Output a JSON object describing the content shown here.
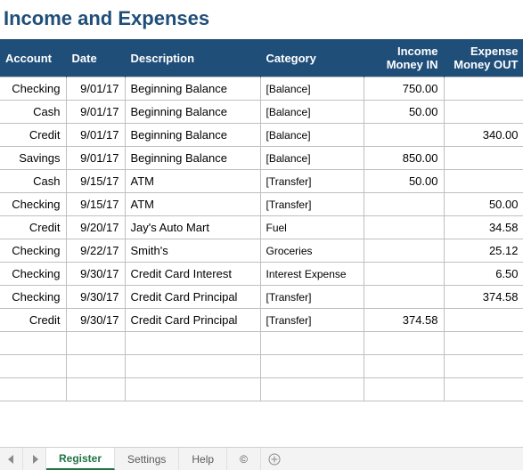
{
  "title": "Income and Expenses",
  "columns": {
    "account": "Account",
    "date": "Date",
    "description": "Description",
    "category": "Category",
    "income": "Income Money IN",
    "expense": "Expense Money OUT"
  },
  "rows": [
    {
      "account": "Checking",
      "date": "9/01/17",
      "description": "Beginning Balance",
      "category": "[Balance]",
      "income": "750.00",
      "expense": ""
    },
    {
      "account": "Cash",
      "date": "9/01/17",
      "description": "Beginning Balance",
      "category": "[Balance]",
      "income": "50.00",
      "expense": ""
    },
    {
      "account": "Credit",
      "date": "9/01/17",
      "description": "Beginning Balance",
      "category": "[Balance]",
      "income": "",
      "expense": "340.00"
    },
    {
      "account": "Savings",
      "date": "9/01/17",
      "description": "Beginning Balance",
      "category": "[Balance]",
      "income": "850.00",
      "expense": ""
    },
    {
      "account": "Cash",
      "date": "9/15/17",
      "description": "ATM",
      "category": "[Transfer]",
      "income": "50.00",
      "expense": ""
    },
    {
      "account": "Checking",
      "date": "9/15/17",
      "description": "ATM",
      "category": "[Transfer]",
      "income": "",
      "expense": "50.00"
    },
    {
      "account": "Credit",
      "date": "9/20/17",
      "description": "Jay's Auto Mart",
      "category": "Fuel",
      "income": "",
      "expense": "34.58"
    },
    {
      "account": "Checking",
      "date": "9/22/17",
      "description": "Smith's",
      "category": "Groceries",
      "income": "",
      "expense": "25.12"
    },
    {
      "account": "Checking",
      "date": "9/30/17",
      "description": "Credit Card Interest",
      "category": "Interest Expense",
      "income": "",
      "expense": "6.50"
    },
    {
      "account": "Checking",
      "date": "9/30/17",
      "description": "Credit Card Principal",
      "category": "[Transfer]",
      "income": "",
      "expense": "374.58"
    },
    {
      "account": "Credit",
      "date": "9/30/17",
      "description": "Credit Card Principal",
      "category": "[Transfer]",
      "income": "374.58",
      "expense": ""
    },
    {
      "account": "",
      "date": "",
      "description": "",
      "category": "",
      "income": "",
      "expense": ""
    },
    {
      "account": "",
      "date": "",
      "description": "",
      "category": "",
      "income": "",
      "expense": ""
    },
    {
      "account": "",
      "date": "",
      "description": "",
      "category": "",
      "income": "",
      "expense": ""
    }
  ],
  "tabs": {
    "items": [
      "Register",
      "Settings",
      "Help",
      "©"
    ],
    "active_index": 0
  }
}
